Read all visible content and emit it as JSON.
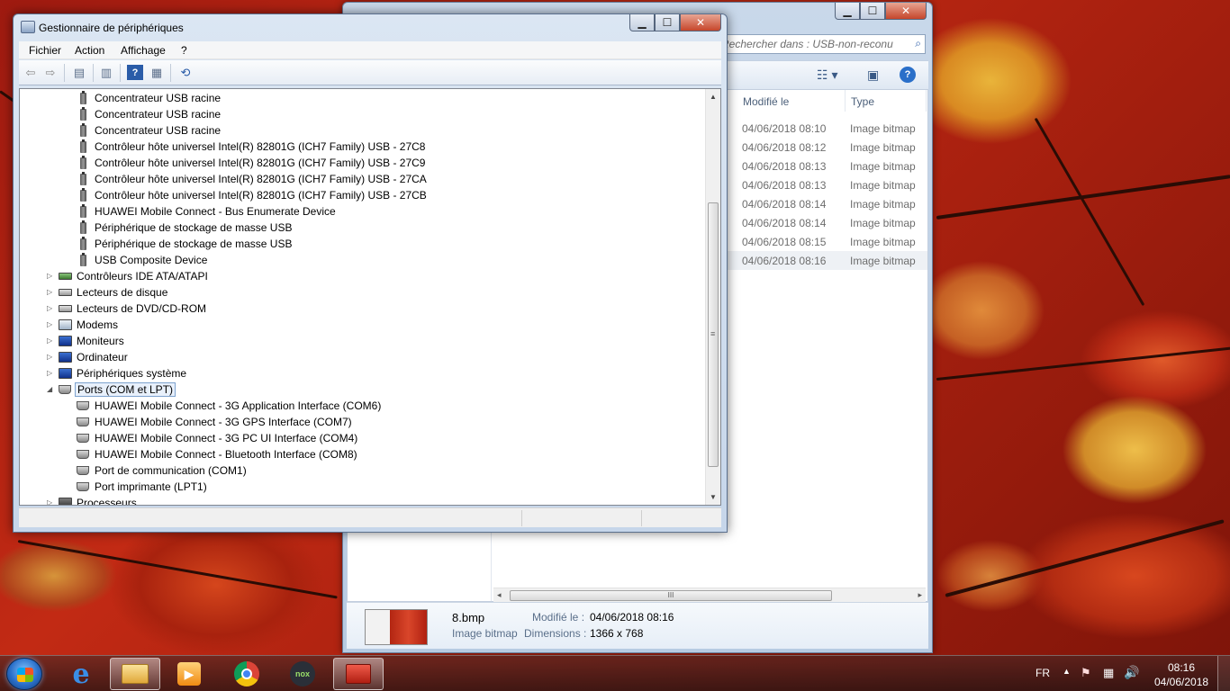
{
  "explorer": {
    "search_placeholder": "Rechercher dans : USB-non-reconu",
    "columns": {
      "modified": "Modifié le",
      "type": "Type"
    },
    "files": [
      {
        "modified": "04/06/2018 08:10",
        "type": "Image bitmap"
      },
      {
        "modified": "04/06/2018 08:12",
        "type": "Image bitmap"
      },
      {
        "modified": "04/06/2018 08:13",
        "type": "Image bitmap"
      },
      {
        "modified": "04/06/2018 08:13",
        "type": "Image bitmap"
      },
      {
        "modified": "04/06/2018 08:14",
        "type": "Image bitmap"
      },
      {
        "modified": "04/06/2018 08:14",
        "type": "Image bitmap"
      },
      {
        "modified": "04/06/2018 08:15",
        "type": "Image bitmap"
      },
      {
        "modified": "04/06/2018 08:16",
        "type": "Image bitmap"
      }
    ],
    "details": {
      "name": "8.bmp",
      "type": "Image bitmap",
      "modified_label": "Modifié le :",
      "modified_value": "04/06/2018 08:16",
      "dimensions_label": "Dimensions :",
      "dimensions_value": "1366 x 768"
    },
    "hscroll_grip": "III"
  },
  "devmgr": {
    "title": "Gestionnaire de périphériques",
    "menu": [
      "Fichier",
      "Action",
      "Affichage",
      "?"
    ],
    "usb_children": [
      "Concentrateur USB racine",
      "Concentrateur USB racine",
      "Concentrateur USB racine",
      "Contrôleur hôte universel Intel(R) 82801G (ICH7 Family) USB - 27C8",
      "Contrôleur hôte universel Intel(R) 82801G (ICH7 Family) USB - 27C9",
      "Contrôleur hôte universel Intel(R) 82801G (ICH7 Family) USB - 27CA",
      "Contrôleur hôte universel Intel(R) 82801G (ICH7 Family) USB - 27CB",
      "HUAWEI Mobile Connect - Bus Enumerate Device",
      "Périphérique de stockage de masse USB",
      "Périphérique de stockage de masse USB",
      "USB Composite Device"
    ],
    "categories": [
      {
        "label": "Contrôleurs IDE ATA/ATAPI",
        "icon": "ide-controller-icon"
      },
      {
        "label": "Lecteurs de disque",
        "icon": "disk-drive-icon"
      },
      {
        "label": "Lecteurs de DVD/CD-ROM",
        "icon": "dvd-drive-icon"
      },
      {
        "label": "Modems",
        "icon": "modem-icon"
      },
      {
        "label": "Moniteurs",
        "icon": "monitor-icon"
      },
      {
        "label": "Ordinateur",
        "icon": "computer-icon"
      },
      {
        "label": "Périphériques système",
        "icon": "system-devices-icon"
      }
    ],
    "ports": {
      "label": "Ports (COM et LPT)",
      "children": [
        "HUAWEI Mobile Connect - 3G Application Interface (COM6)",
        "HUAWEI Mobile Connect - 3G GPS Interface (COM7)",
        "HUAWEI Mobile Connect - 3G PC UI Interface (COM4)",
        "HUAWEI Mobile Connect - Bluetooth Interface (COM8)",
        "Port de communication (COM1)",
        "Port imprimante (LPT1)"
      ]
    },
    "processors": "Processeurs",
    "help_glyph": "?"
  },
  "taskbar": {
    "language": "FR",
    "time": "08:16",
    "date": "04/06/2018",
    "nox_label": "nox"
  },
  "colors": {
    "accent": "#2a6fc9",
    "selection_border": "#7da2ce",
    "close_button": "#c6462b"
  }
}
